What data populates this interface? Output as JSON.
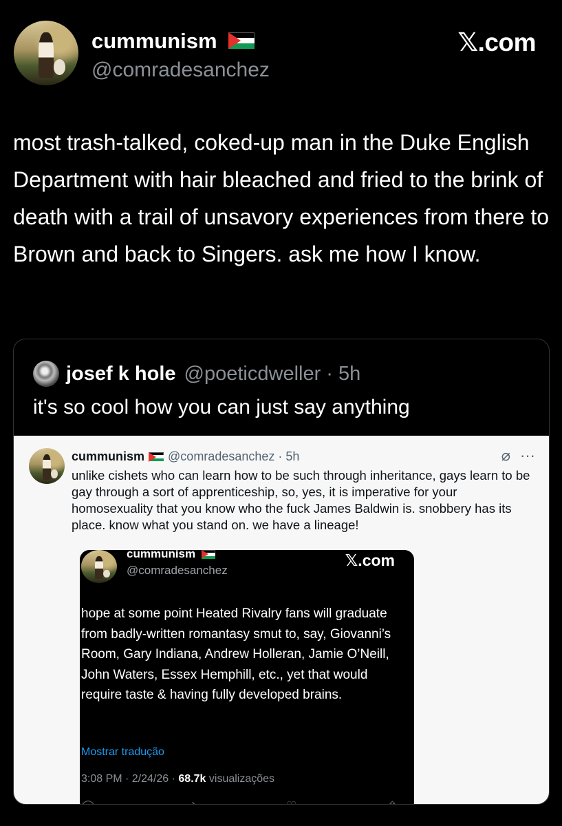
{
  "header": {
    "name": "cummunism",
    "handle": "@comradesanchez",
    "brand": "𝕏.com"
  },
  "post": {
    "text": "most trash-talked, coked-up man in the Duke English Department with hair bleached and fried to the brink of death with a trail of unsavory experiences from there to Brown and back to Singers. ask me how I know."
  },
  "quote": {
    "name": "josef k hole",
    "handle": "@poeticdweller · 5h",
    "text": "it's so cool how you can just say anything"
  },
  "embed": {
    "name": "cummunism",
    "handle": "@comradesanchez · 5h",
    "text": "unlike cishets who can learn how to be such through inheritance, gays learn to be gay through a sort of apprenticeship, so, yes, it is imperative for your homosexuality that you know who the fuck James Baldwin is. snobbery has its place. know what you stand on. we have a lineage!",
    "more_icon": "···",
    "grok_icon": "⌀"
  },
  "inner": {
    "name": "cummunism",
    "handle": "@comradesanchez",
    "brand": "𝕏.com",
    "text": "hope at some point Heated Rivalry fans will graduate from badly-written romantasy smut to, say, Giovanni’s Room, Gary Indiana, Andrew Holleran, Jamie O’Neill, John Waters, Essex Hemphill, etc., yet that would require taste & having fully developed brains.",
    "translate": "Mostrar tradução",
    "meta_time": "3:08 PM · 2/24/26 · ",
    "views_count": "68.7k",
    "views_label": " visualizações"
  },
  "colors": {
    "background": "#000000",
    "handle_gray": "#8b9096",
    "link_blue": "#1d9bf0",
    "embed_bg": "#f7f7f7"
  }
}
